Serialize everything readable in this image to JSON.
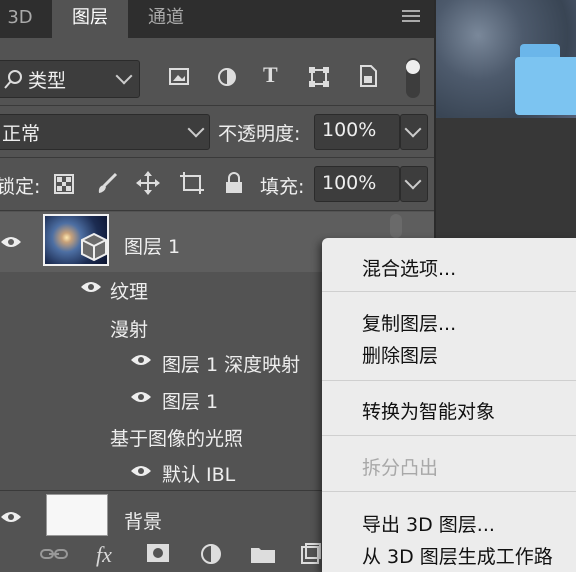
{
  "tabs": [
    {
      "label": "3D",
      "active": false
    },
    {
      "label": "图层",
      "active": true
    },
    {
      "label": "通道",
      "active": false
    }
  ],
  "filter": {
    "label": "类型",
    "icon": "search-icon"
  },
  "blend_mode": "正常",
  "opacity": {
    "label": "不透明度:",
    "value": "100%"
  },
  "lock": {
    "label": "锁定:"
  },
  "fill": {
    "label": "填充:",
    "value": "100%"
  },
  "layers": {
    "layer1": "图层 1",
    "texture": "纹理",
    "diffuse": "漫射",
    "depth_map": "图层 1 深度映射",
    "sub_layer1": "图层 1",
    "ibl_group": "基于图像的光照",
    "default_ibl": "默认 IBL",
    "background": "背景"
  },
  "context_menu": {
    "blend_options": "混合选项...",
    "duplicate_layer": "复制图层...",
    "delete_layer": "删除图层",
    "convert_smart": "转换为智能对象",
    "split_extrusion": "拆分凸出",
    "export_3d": "导出 3D 图层...",
    "generate_work": "从 3D 图层生成工作路"
  },
  "bottom_bar": {
    "fx": "fx"
  },
  "colors": {
    "panel": "#535353",
    "menu_bg": "#ececec",
    "folder": "#7cc4f1"
  }
}
